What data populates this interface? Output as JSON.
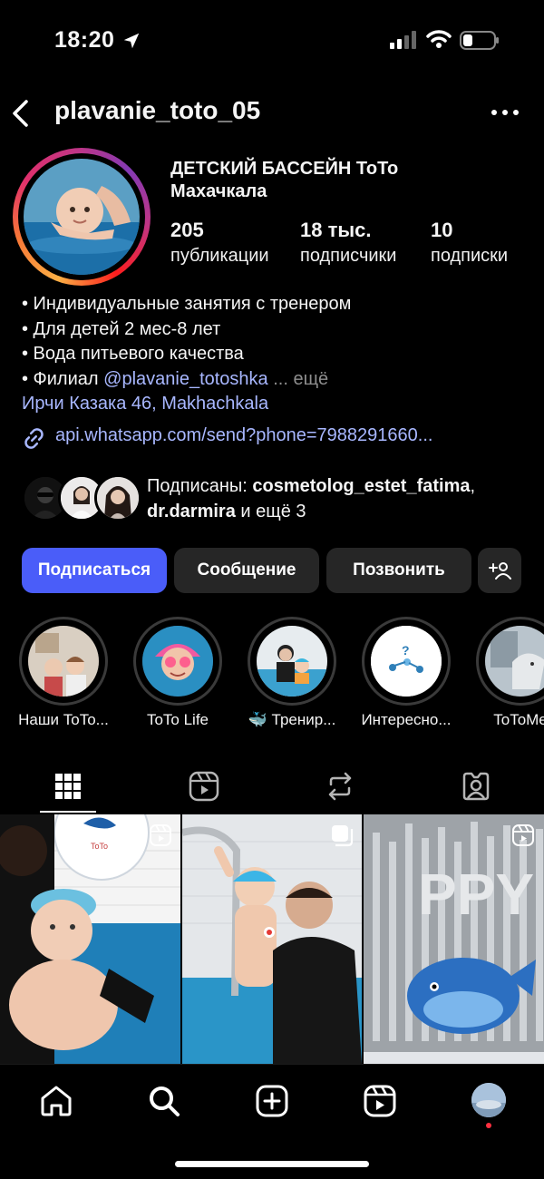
{
  "status_bar": {
    "time": "18:20"
  },
  "header": {
    "username": "plavanie_toto_05"
  },
  "profile": {
    "name_line1": "ДЕТСКИЙ БАССЕЙН ТоТо",
    "name_line2": "Махачкала",
    "stats": [
      {
        "value": "205",
        "label": "публикации"
      },
      {
        "value": "18 тыс.",
        "label": "подписчики"
      },
      {
        "value": "10",
        "label": "подписки"
      }
    ]
  },
  "bio": {
    "lines": [
      "• Индивидуальные занятия с тренером",
      "• Для детей 2 мес-8 лет",
      "• Вода питьевого качества"
    ],
    "branch_prefix": "• Филиал ",
    "branch_mention": "@plavanie_totoshka",
    "more": " ... ещё",
    "address": "Ирчи Казака 46, Makhachkala",
    "link": "api.whatsapp.com/send?phone=7988291660..."
  },
  "followed_by": {
    "prefix": "Подписаны: ",
    "user1": "cosmetolog_estet_fatima",
    "sep": ", ",
    "user2": "dr.darmira",
    "suffix": " и ещё 3"
  },
  "buttons": {
    "follow": "Подписаться",
    "message": "Сообщение",
    "call": "Позвонить"
  },
  "highlights": [
    {
      "label": "Наши ToTo..."
    },
    {
      "label": "ToTo Life"
    },
    {
      "label": "🐳 Тренир..."
    },
    {
      "label": "Интересно..."
    },
    {
      "label": "ToToMe"
    }
  ],
  "colors": {
    "background": "#000000",
    "primary_button": "#4a5df9",
    "secondary_button": "#262626",
    "link": "#a8b7ff",
    "notification_dot": "#ff3040"
  }
}
